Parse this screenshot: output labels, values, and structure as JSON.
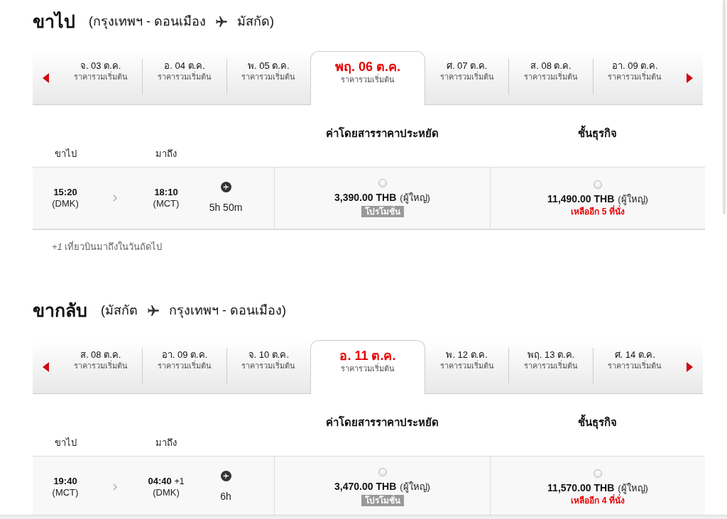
{
  "sections": [
    {
      "title": "ขาไป",
      "route": {
        "origin": "(กรุงเทพฯ - ดอนเมือง",
        "destination": "มัสกัด)"
      },
      "dates": [
        {
          "day": "จ. 03 ต.ค.",
          "caption": "ราคารวมเริ่มต้น",
          "selected": false
        },
        {
          "day": "อ. 04 ต.ค.",
          "caption": "ราคารวมเริ่มต้น",
          "selected": false
        },
        {
          "day": "พ. 05 ต.ค.",
          "caption": "ราคารวมเริ่มต้น",
          "selected": false
        },
        {
          "day": "พฤ. 06 ต.ค.",
          "caption": "ราคารวมเริ่มต้น",
          "selected": true
        },
        {
          "day": "ศ. 07 ต.ค.",
          "caption": "ราคารวมเริ่มต้น",
          "selected": false
        },
        {
          "day": "ส. 08 ต.ค.",
          "caption": "ราคารวมเริ่มต้น",
          "selected": false
        },
        {
          "day": "อา. 09 ต.ค.",
          "caption": "ราคารวมเริ่มต้น",
          "selected": false
        }
      ],
      "fare_classes": [
        "ค่าโดยสารราคาประหยัด",
        "ชั้นธุรกิจ"
      ],
      "column_labels": [
        "ขาไป",
        "มาถึง"
      ],
      "flights": [
        {
          "depart_time": "15:20",
          "depart_airport": "(DMK)",
          "arrive_time": "18:10",
          "arrive_airport": "(MCT)",
          "duration": "5h 50m",
          "fares": [
            {
              "price": "3,390.00 THB",
              "passenger": "(ผู้ใหญ่)",
              "selected": false,
              "badge": "โปรโมชั่น"
            },
            {
              "price": "11,490.00 THB",
              "passenger": "(ผู้ใหญ่)",
              "selected": false,
              "note": "เหลืออีก 5 ที่นั่ง"
            }
          ]
        }
      ],
      "footnote": "*+1* เที่ยวบินมาถึงในวันถัดไป"
    },
    {
      "title": "ขากลับ",
      "route": {
        "origin": "(มัสกัต",
        "destination": "กรุงเทพฯ - ดอนเมือง)"
      },
      "dates": [
        {
          "day": "ส. 08 ต.ค.",
          "caption": "ราคารวมเริ่มต้น",
          "selected": false
        },
        {
          "day": "อา. 09 ต.ค.",
          "caption": "ราคารวมเริ่มต้น",
          "selected": false
        },
        {
          "day": "จ. 10 ต.ค.",
          "caption": "ราคารวมเริ่มต้น",
          "selected": false
        },
        {
          "day": "อ. 11 ต.ค.",
          "caption": "ราคารวมเริ่มต้น",
          "selected": true
        },
        {
          "day": "พ. 12 ต.ค.",
          "caption": "ราคารวมเริ่มต้น",
          "selected": false
        },
        {
          "day": "พฤ. 13 ต.ค.",
          "caption": "ราคารวมเริ่มต้น",
          "selected": false
        },
        {
          "day": "ศ. 14 ต.ค.",
          "caption": "ราคารวมเริ่มต้น",
          "selected": false
        }
      ],
      "fare_classes": [
        "ค่าโดยสารราคาประหยัด",
        "ชั้นธุรกิจ"
      ],
      "column_labels": [
        "ขาไป",
        "มาถึง"
      ],
      "flights": [
        {
          "depart_time": "19:40",
          "depart_airport": "(MCT)",
          "arrive_time": "04:40",
          "arrive_offset": "+1",
          "arrive_airport": "(DMK)",
          "duration": "6h",
          "fares": [
            {
              "price": "3,470.00 THB",
              "passenger": "(ผู้ใหญ่)",
              "selected": false,
              "badge": "โปรโมชั่น"
            },
            {
              "price": "11,570.00 THB",
              "passenger": "(ผู้ใหญ่)",
              "selected": false,
              "note": "เหลืออีก 4 ที่นั่ง"
            }
          ]
        }
      ]
    }
  ]
}
